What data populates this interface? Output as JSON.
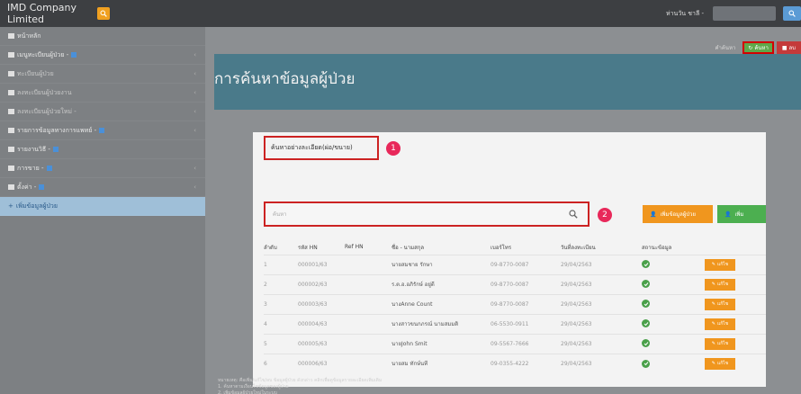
{
  "topbar": {
    "brand": "IMD Company Limited",
    "user": "ห่านวัน ชาลี -"
  },
  "sidebar": {
    "items": [
      {
        "label": "หน้าหลัก",
        "badge": false,
        "arrow": false,
        "state": "normal"
      },
      {
        "label": "เมนูทะเบียนผู้ป่วย -",
        "badge": true,
        "arrow": true,
        "state": "normal"
      },
      {
        "label": "ทะเบียนผู้ป่วย",
        "badge": false,
        "arrow": true,
        "state": "dim"
      },
      {
        "label": "ลงทะเบียนผู้ป่วยงาน",
        "badge": false,
        "arrow": true,
        "state": "dim"
      },
      {
        "label": "ลงทะเบียนผู้ป่วยใหม่ -",
        "badge": false,
        "arrow": true,
        "state": "dim"
      },
      {
        "label": "รายการข้อมูลทางการแพทย์ -",
        "badge": true,
        "arrow": true,
        "state": "normal"
      },
      {
        "label": "รายงานวิธี -",
        "badge": true,
        "arrow": false,
        "state": "normal"
      },
      {
        "label": "การขาย -",
        "badge": true,
        "arrow": true,
        "state": "normal"
      },
      {
        "label": "ตั้งค่า -",
        "badge": true,
        "arrow": true,
        "state": "normal"
      },
      {
        "label": "เพิ่มข้อมูลผู้ป่วย",
        "badge": false,
        "arrow": false,
        "state": "active"
      }
    ]
  },
  "main": {
    "breadcrumb": "คำค้นหา",
    "refresh_label": "ค้นหา",
    "delete_label": "ลบ",
    "title": "การค้นหาข้อมูลผู้ป่วย",
    "filter_tab": "ค้นหาอย่างละเอียด(ผ่อ/ขนาย)",
    "step1": "1",
    "step2": "2",
    "search_placeholder": "ค้นหา",
    "orange_button": "เพิ่มข้อมูลผู้ป่วย",
    "green_button": "เพิ่ม",
    "table": {
      "headers": [
        "ลำดับ",
        "รหัส HN",
        "Ref HN",
        "ชื่อ - นามสกุล",
        "เบอร์โทร",
        "วันที่ลงทะเบียน",
        "สถานะข้อมูล",
        ""
      ],
      "rows": [
        {
          "no": "1",
          "hn": "000001/63",
          "name": "นายสมชาย รักษา",
          "phone": "09-8770-0087",
          "date": "29/04/2563"
        },
        {
          "no": "2",
          "hn": "000002/63",
          "name": "ร.ต.อ.อภิรักษ์ อยู่ดี",
          "phone": "09-8770-0087",
          "date": "29/04/2563"
        },
        {
          "no": "3",
          "hn": "000003/63",
          "name": "นางAnne Count",
          "phone": "09-8770-0087",
          "date": "29/04/2563"
        },
        {
          "no": "4",
          "hn": "000004/63",
          "name": "นางสาวขนกภรณ์ นามสมมติ",
          "phone": "06-5530-0911",
          "date": "29/04/2563"
        },
        {
          "no": "5",
          "hn": "000005/63",
          "name": "นายJohn Smit",
          "phone": "09-5567-7666",
          "date": "29/04/2563"
        },
        {
          "no": "6",
          "hn": "000006/63",
          "name": "นายสม ทักษ์นที",
          "phone": "09-0355-4222",
          "date": "29/04/2563"
        }
      ],
      "edit_label": "แก้ไข"
    },
    "footnote": "หมายเหตุ: คือเพิ่ม/แก้ไข/ลบ ข้อมูลผู้ป่วย ดังกล่าว คลิกเพื่อดูข้อมูลรายละเอียดเพิ่มเติม\n1. ค้นหาตามเงื่อนไขข้อมูลของผู้ป่วย\n2. เพิ่มข้อมูลผู้ป่วยใหม่ในระบบ"
  },
  "colors": {
    "accent_red": "#cc2222",
    "step_pink": "#e8285a",
    "orange": "#f0961e",
    "green": "#4caf50"
  }
}
